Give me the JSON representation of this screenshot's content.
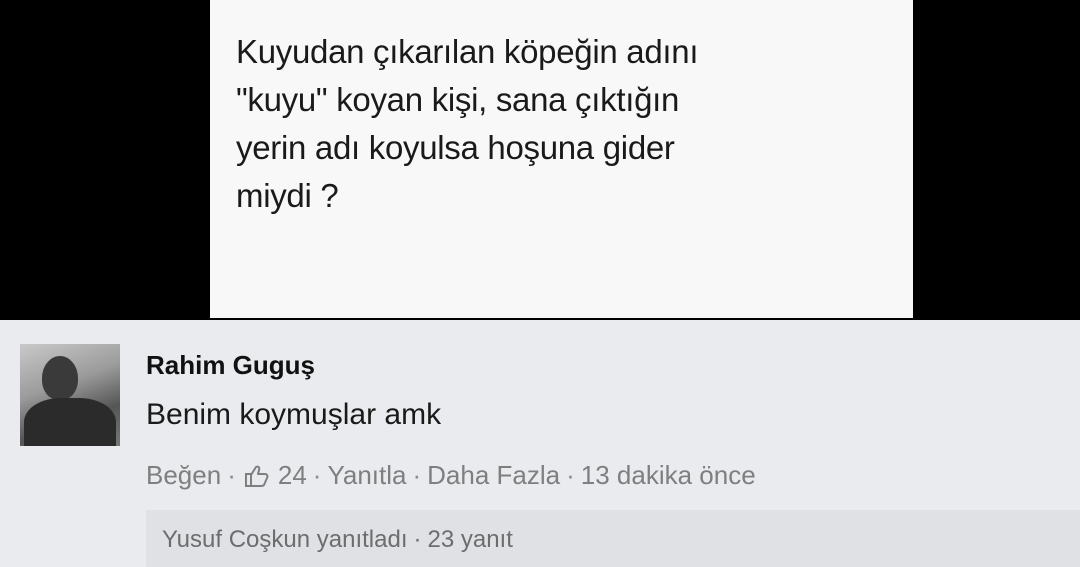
{
  "post": {
    "text": "Kuyudan çıkarılan köpeğin adını\n\"kuyu\" koyan kişi, sana çıktığın\nyerin adı koyulsa hoşuna gider\nmiydi ?"
  },
  "comment": {
    "author": "Rahim Guguş",
    "text": "Benim koymuşlar amk",
    "actions": {
      "like": "Beğen",
      "like_count": "24",
      "reply": "Yanıtla",
      "more": "Daha Fazla",
      "time": "13 dakika önce",
      "separator": "·"
    },
    "replies": {
      "summary": "Yusuf Coşkun yanıtladı",
      "separator": "·",
      "count": "23 yanıt"
    }
  },
  "icons": {
    "like": "thumbs-up-icon"
  },
  "colors": {
    "background_top": "#000000",
    "post_card": "#f8f8f8",
    "comment_bg": "#e9ebee",
    "meta_text": "#7f7f7f"
  }
}
